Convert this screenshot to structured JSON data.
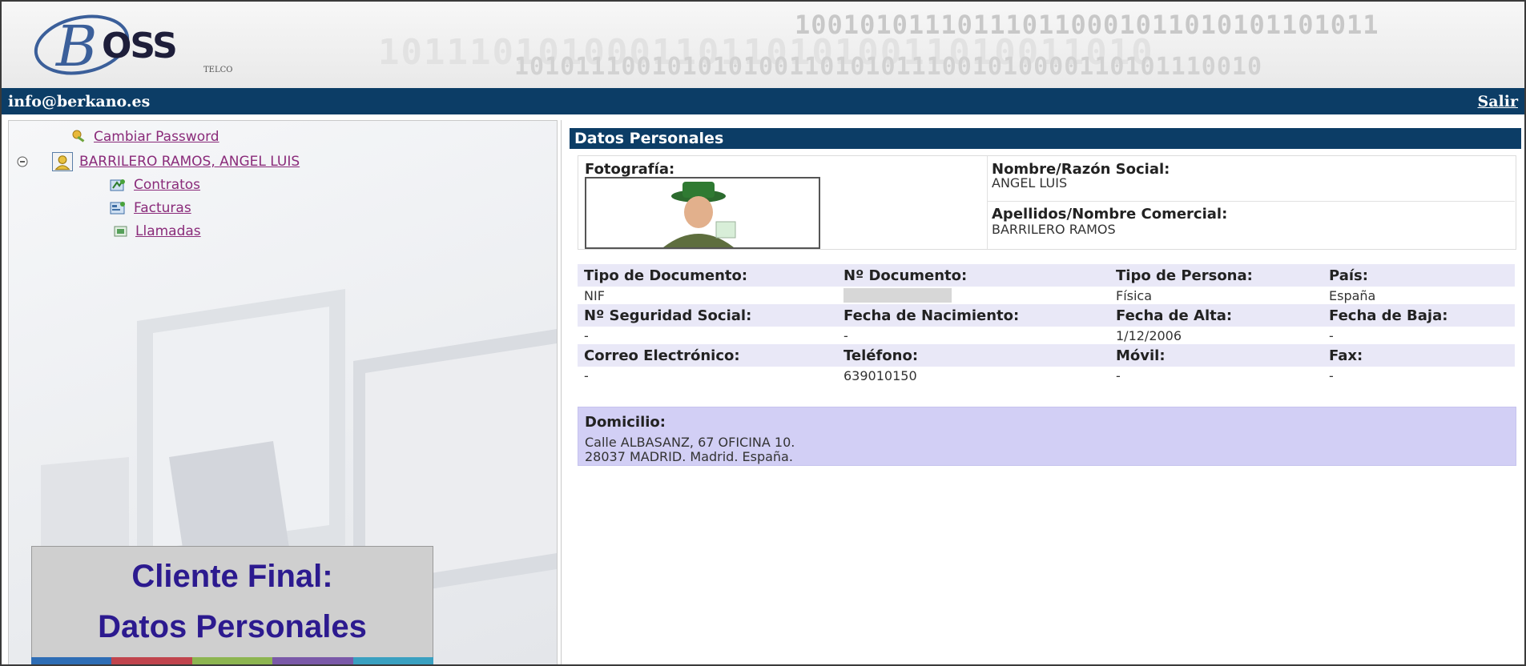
{
  "header": {
    "logo_text": "BOSS",
    "logo_sub": "TELCO",
    "binary_line_1": "100101011101110110001011010101101011",
    "binary_line_2": "1011101010001101101010011010011010",
    "binary_line_3": "1010111001010101001101010111001010000110101110010"
  },
  "userbar": {
    "email": "info@berkano.es",
    "logout_label": "Salir"
  },
  "tree": {
    "change_password": "Cambiar Password",
    "client_name": "BARRILERO RAMOS, ANGEL LUIS",
    "items": [
      {
        "label": "Contratos",
        "icon": "contracts-icon"
      },
      {
        "label": "Facturas",
        "icon": "invoices-icon"
      },
      {
        "label": "Llamadas",
        "icon": "calls-icon"
      }
    ]
  },
  "caption": {
    "line1": "Cliente Final:",
    "line2": "Datos Personales"
  },
  "stripe_colors": [
    "#2e6db5",
    "#c0444d",
    "#8db551",
    "#7a59a8",
    "#3aa0c0"
  ],
  "personal": {
    "section_title": "Datos Personales",
    "photo_label": "Fotografía:",
    "name_label": "Nombre/Razón Social:",
    "name_value": "ANGEL LUIS",
    "surname_label": "Apellidos/Nombre Comercial:",
    "surname_value": "BARRILERO RAMOS",
    "doc_type_label": "Tipo de Documento:",
    "doc_type_value": "NIF",
    "doc_number_label": "Nº Documento:",
    "person_type_label": "Tipo de Persona:",
    "person_type_value": "Física",
    "country_label": "País:",
    "country_value": "España",
    "ss_label": "Nº Seguridad Social:",
    "ss_value": "-",
    "birth_label": "Fecha de Nacimiento:",
    "birth_value": "-",
    "alta_label": "Fecha de Alta:",
    "alta_value": "1/12/2006",
    "baja_label": "Fecha de Baja:",
    "baja_value": "-",
    "email_label": "Correo Electrónico:",
    "email_value": "-",
    "phone_label": "Teléfono:",
    "phone_value": "639010150",
    "mobile_label": "Móvil:",
    "mobile_value": "-",
    "fax_label": "Fax:",
    "fax_value": "-",
    "address_label": "Domicilio:",
    "address_line1": "Calle ALBASANZ, 67 OFICINA 10.",
    "address_line2": "28037 MADRID. Madrid. España."
  }
}
